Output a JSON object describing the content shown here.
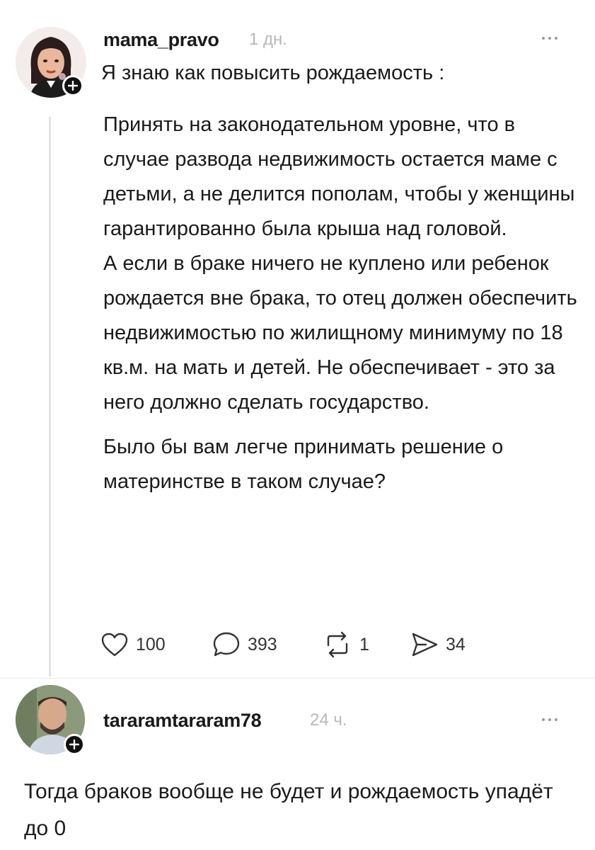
{
  "post": {
    "username": "mama_pravo",
    "time": "1 дн.",
    "title": "Я знаю как повысить рождаемость :",
    "paragraphs": [
      "Принять на законодательном уровне, что в случае развода недвижимость остается маме с детьми, а не делится пополам, чтобы у женщины гарантированно была крыша над головой.",
      "А если в браке ничего не куплено или ребенок рождается вне брака, то отец должен обеспечить недвижимостью по жилищному минимуму по 18 кв.м. на мать и детей. Не обеспечивает - это за него должно сделать государство.",
      "Было бы вам легче принимать решение о материнстве в таком случае?"
    ],
    "actions": {
      "likes": "100",
      "comments": "393",
      "reposts": "1",
      "shares": "34"
    }
  },
  "reply": {
    "username": "tararamtararam78",
    "time": "24 ч.",
    "text": "Тогда браков вообще не будет и рождаемость упадёт до 0"
  },
  "icons": {
    "follow": "plus-icon",
    "menu": "more-dots-icon",
    "like": "heart-icon",
    "comment": "comment-bubble-icon",
    "repost": "repost-icon",
    "share": "send-icon"
  },
  "colors": {
    "text": "#1a1a1a",
    "muted": "#b8b8b8",
    "badge": "#111111",
    "thread": "#e3e3e3"
  }
}
